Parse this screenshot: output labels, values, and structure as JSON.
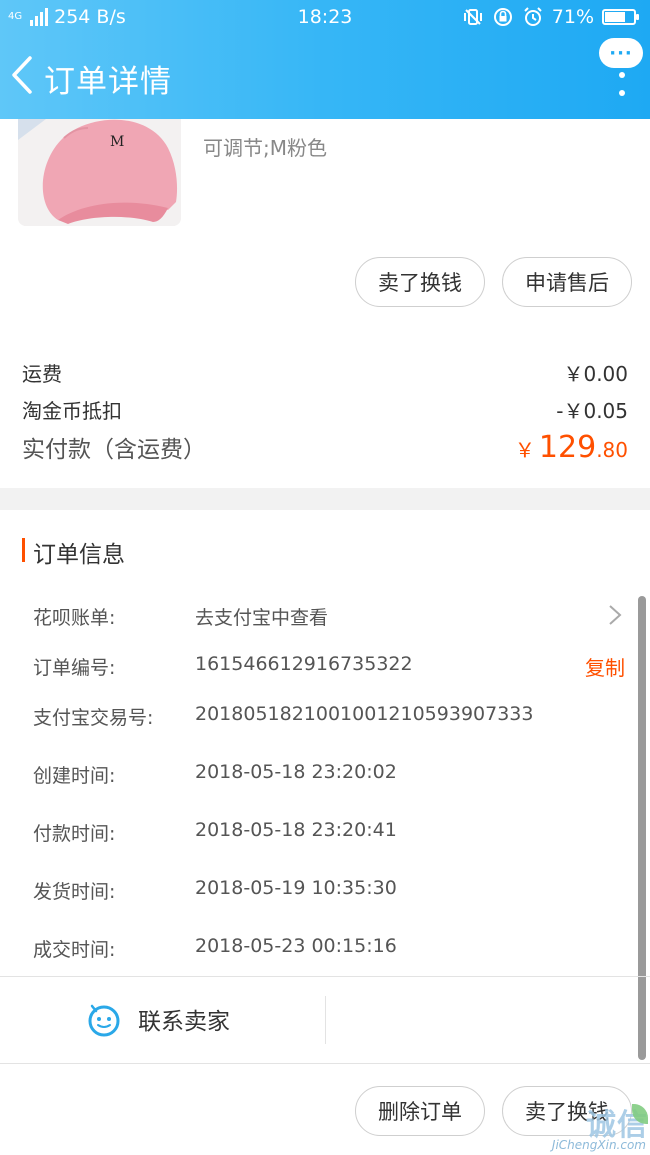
{
  "status_bar": {
    "network_tag": "4G",
    "net_speed": "254 B/s",
    "time": "18:23",
    "battery": "71%",
    "battery_level": 0.71
  },
  "nav": {
    "title": "订单详情",
    "more_label": "···"
  },
  "product": {
    "sku": "可调节;M粉色",
    "logo_letter": "M"
  },
  "actions_top": {
    "sell_exchange": "卖了换钱",
    "after_sale": "申请售后"
  },
  "fees": {
    "shipping_label": "运费",
    "shipping_value": "￥0.00",
    "coin_label": "淘金币抵扣",
    "coin_value": "-￥0.05",
    "paid_label": "实付款（含运费）",
    "paid_symbol": "￥",
    "paid_int": "129",
    "paid_dec": ".80"
  },
  "order_info": {
    "title": "订单信息",
    "rows": [
      {
        "label": "花呗账单:",
        "value": "去支付宝中查看"
      },
      {
        "label": "订单编号:",
        "value": "161546612916735322"
      },
      {
        "label": "支付宝交易号:",
        "value": "2018051821001001210593907333"
      },
      {
        "label": "创建时间:",
        "value": "2018-05-18 23:20:02"
      },
      {
        "label": "付款时间:",
        "value": "2018-05-18 23:20:41"
      },
      {
        "label": "发货时间:",
        "value": "2018-05-19 10:35:30"
      },
      {
        "label": "成交时间:",
        "value": "2018-05-23 00:15:16"
      }
    ],
    "copy_label": "复制"
  },
  "contact": {
    "label": "联系卖家"
  },
  "actions_bottom": {
    "delete_order": "删除订单",
    "sell_exchange": "卖了换钱"
  },
  "watermark": {
    "text": "诚信",
    "sub": "JiChengXin.com"
  },
  "colors": {
    "header_start": "#5fc7f8",
    "header_end": "#1ea9f3",
    "accent": "#ff5000",
    "contact_icon": "#2aa8e8"
  }
}
